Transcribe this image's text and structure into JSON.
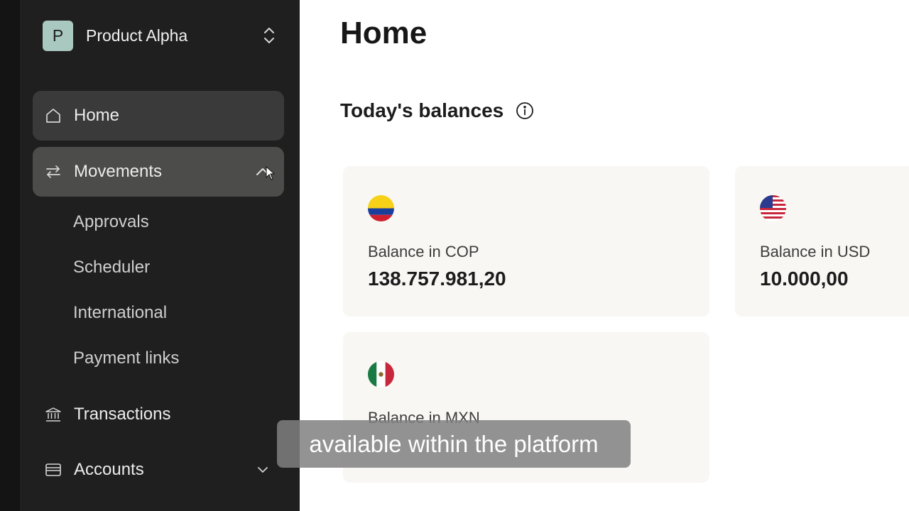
{
  "workspace": {
    "initial": "P",
    "name": "Product Alpha"
  },
  "sidebar": {
    "items": [
      {
        "label": "Home",
        "icon": "home-icon"
      },
      {
        "label": "Movements",
        "icon": "arrows-swap-icon",
        "expanded": true
      },
      {
        "label": "Transactions",
        "icon": "bank-icon"
      },
      {
        "label": "Accounts",
        "icon": "wallet-icon"
      }
    ],
    "submenu": [
      "Approvals",
      "Scheduler",
      "International",
      "Payment links"
    ]
  },
  "main": {
    "title": "Home",
    "section_title": "Today's balances",
    "balances": [
      {
        "label": "Balance in COP",
        "value": "138.757.981,20",
        "flag": "colombia-flag-icon"
      },
      {
        "label": "Balance in USD",
        "value": "10.000,00",
        "flag": "usa-flag-icon"
      },
      {
        "label": "Balance in MXN",
        "value": "",
        "flag": "mexico-flag-icon"
      }
    ]
  },
  "caption": "available within the platform",
  "colors": {
    "sidebar_bg": "#1f1f1f",
    "card_bg": "#f9f7f3",
    "avatar": "#a9c8bf"
  }
}
